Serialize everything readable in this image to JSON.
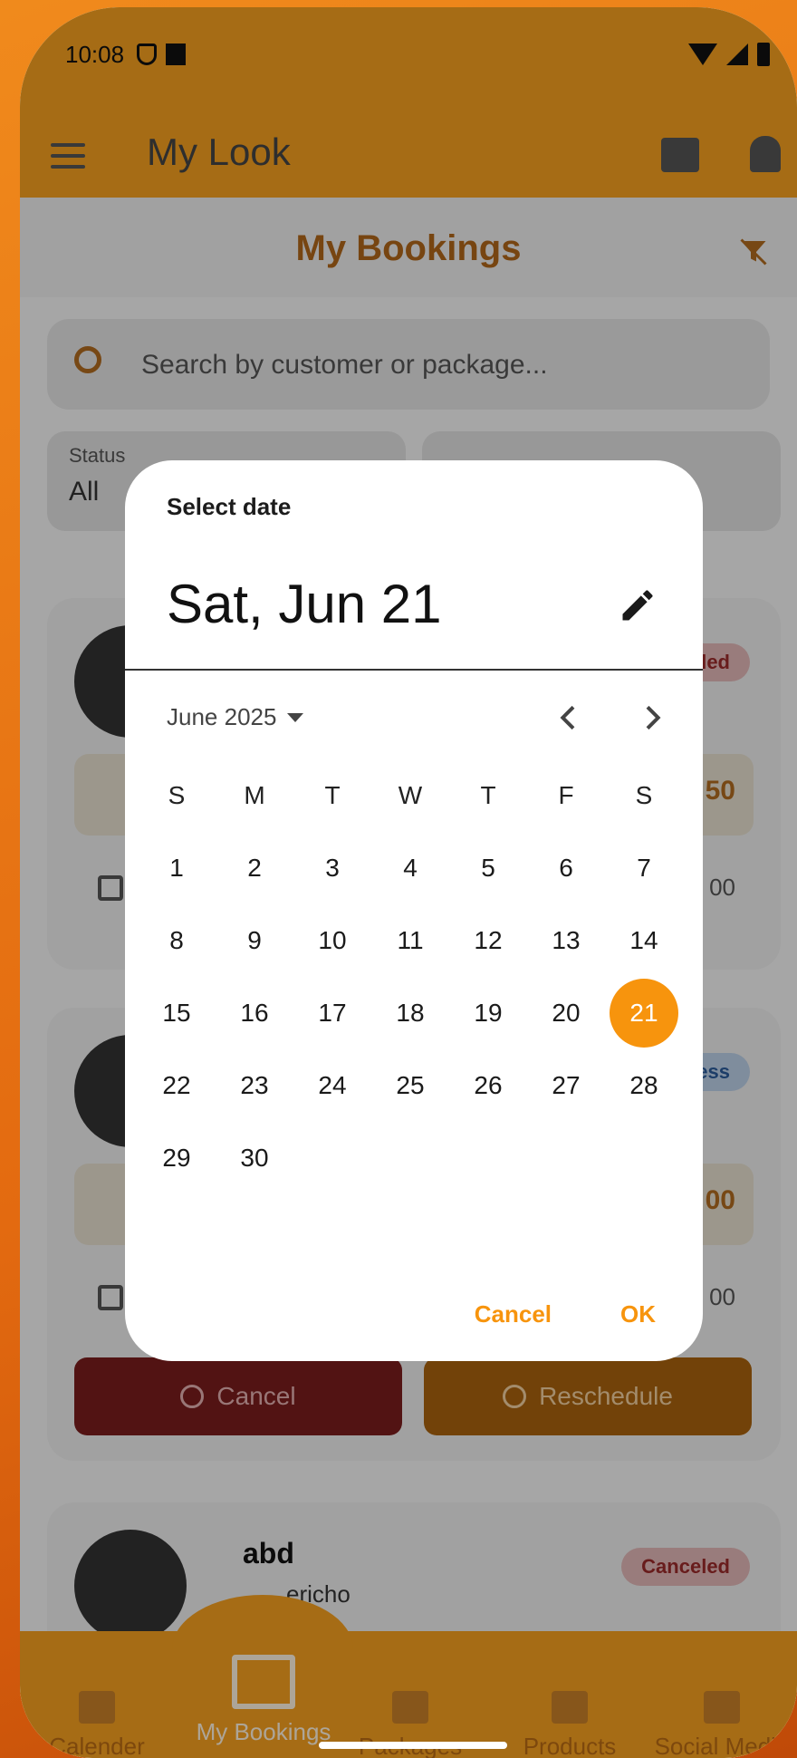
{
  "status_bar": {
    "time": "10:08"
  },
  "app": {
    "title": "My Look",
    "page_title": "My Bookings",
    "search_placeholder": "Search by customer or package...",
    "status_filter": {
      "label": "Status",
      "value": "All"
    }
  },
  "cards": [
    {
      "name": "",
      "location": "",
      "badge": "led",
      "price": "50",
      "time": "00"
    },
    {
      "name": "",
      "location": "",
      "badge": "ess",
      "price": "00",
      "time": "00",
      "cancel_label": "Cancel",
      "reschedule_label": "Reschedule"
    },
    {
      "name": "abd",
      "location": "ericho",
      "badge": "Canceled"
    }
  ],
  "bottom_nav": [
    {
      "label": "Calender",
      "icon": "calendar-icon"
    },
    {
      "label": "My Bookings",
      "icon": "calendar-icon",
      "active": true
    },
    {
      "label": "Packages",
      "icon": "packages-icon"
    },
    {
      "label": "Products",
      "icon": "products-icon"
    },
    {
      "label": "Social Media",
      "icon": "share-icon"
    }
  ],
  "date_picker": {
    "heading": "Select date",
    "selected_label": "Sat, Jun 21",
    "month_label": "June 2025",
    "weekdays": [
      "S",
      "M",
      "T",
      "W",
      "T",
      "F",
      "S"
    ],
    "first_weekday_index": 0,
    "days_in_month": 30,
    "selected_day": 21,
    "cancel_label": "Cancel",
    "ok_label": "OK",
    "accent_color": "#f7940d"
  }
}
